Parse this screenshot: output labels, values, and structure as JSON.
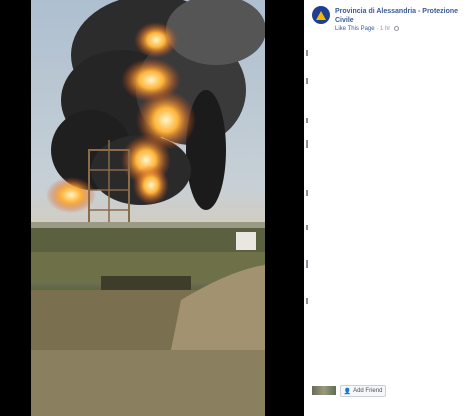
{
  "post": {
    "page_name": "Provincia di Alessandria - Protezione Civile",
    "like_link": "Like This Page",
    "separator": "·",
    "time": "1 hr"
  },
  "actions": {
    "add_friend": "Add Friend"
  },
  "colors": {
    "link": "#3b5998",
    "avatar": "#1d3f8f",
    "avatar_emblem": "#f5b800"
  },
  "icons": {
    "avatar": "civil-protection-logo-icon",
    "privacy": "globe-icon",
    "add_friend": "add-friend-icon"
  }
}
